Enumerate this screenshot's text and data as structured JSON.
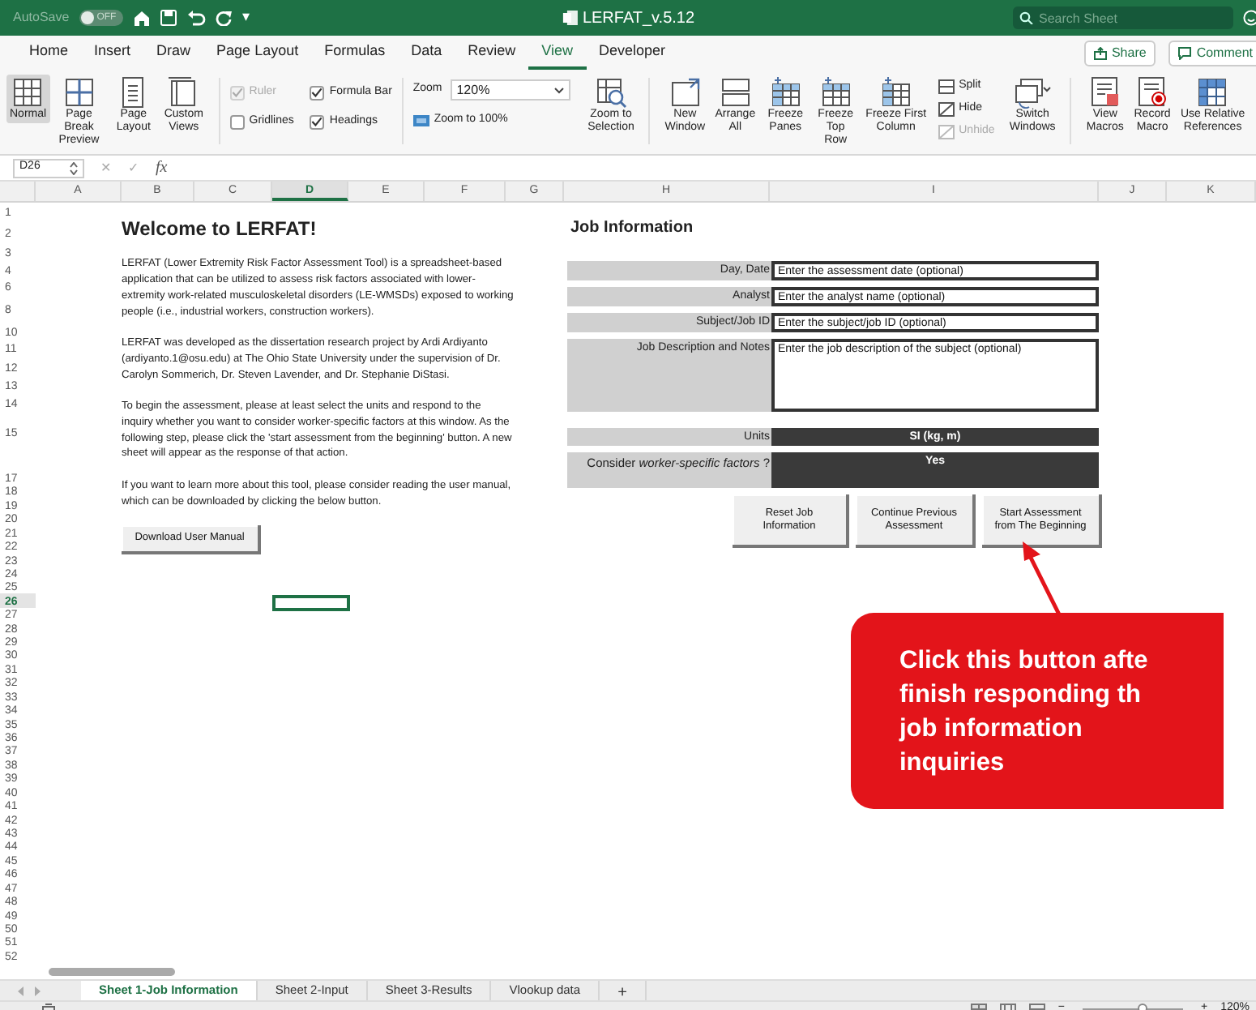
{
  "title_bar": {
    "autosave": "AutoSave",
    "autosave_state": "OFF",
    "autosave_on": false,
    "customize": "▾",
    "title": "LERFAT_v.5.12",
    "search": {
      "placeholder": "Search Sheet"
    }
  },
  "menu_tabs": [
    {
      "label": "Home",
      "selected": false
    },
    {
      "label": "Insert",
      "selected": false
    },
    {
      "label": "Draw",
      "selected": false
    },
    {
      "label": "Page Layout",
      "selected": false
    },
    {
      "label": "Formulas",
      "selected": false
    },
    {
      "label": "Data",
      "selected": false
    },
    {
      "label": "Review",
      "selected": false
    },
    {
      "label": "View",
      "selected": true
    },
    {
      "label": "Developer",
      "selected": false
    }
  ],
  "share": "Share",
  "comment": "Comment",
  "ribbon": {
    "views": [
      {
        "label": "Normal",
        "selected": true
      },
      {
        "label": "Page Break Preview",
        "selected": false
      },
      {
        "label": "Page Layout",
        "selected": false
      },
      {
        "label": "Custom Views",
        "selected": false
      }
    ],
    "show": [
      {
        "label": "Ruler",
        "checked": true,
        "disabled": true
      },
      {
        "label": "Formula Bar",
        "checked": true,
        "disabled": false
      },
      {
        "label": "Gridlines",
        "checked": false,
        "disabled": false
      },
      {
        "label": "Headings",
        "checked": true,
        "disabled": false
      }
    ],
    "zoom": {
      "label": "Zoom",
      "value": "120%",
      "reset": "Zoom to 100%",
      "selection": "Zoom to Selection"
    },
    "window": [
      {
        "label": "New Window"
      },
      {
        "label": "Arrange All"
      },
      {
        "label": "Freeze Panes"
      },
      {
        "label": "Freeze Top Row"
      },
      {
        "label": "Freeze First Column"
      }
    ],
    "split": [
      {
        "label": "Split",
        "disabled": false
      },
      {
        "label": "Hide",
        "disabled": false
      },
      {
        "label": "Unhide",
        "disabled": true
      }
    ],
    "switch": "Switch Windows",
    "macros": [
      {
        "label": "View Macros"
      },
      {
        "label": "Record Macro"
      },
      {
        "label": "Use Relative References"
      }
    ]
  },
  "formula_bar": {
    "cell": "D26",
    "cancel": "✕",
    "enter": "✓",
    "fx": "fx"
  },
  "columns": [
    {
      "label": "A",
      "selected": false
    },
    {
      "label": "B",
      "selected": false
    },
    {
      "label": "C",
      "selected": false
    },
    {
      "label": "D",
      "selected": true
    },
    {
      "label": "E",
      "selected": false
    },
    {
      "label": "F",
      "selected": false
    },
    {
      "label": "G",
      "selected": false
    },
    {
      "label": "H",
      "selected": false
    },
    {
      "label": "I",
      "selected": false
    },
    {
      "label": "J",
      "selected": false
    },
    {
      "label": "K",
      "selected": false
    }
  ],
  "rows": [
    {
      "label": "1",
      "selected": false
    },
    {
      "label": "2",
      "selected": false
    },
    {
      "label": "3",
      "selected": false
    },
    {
      "label": "4",
      "selected": false
    },
    {
      "label": "6",
      "selected": false
    },
    {
      "label": "8",
      "selected": false
    },
    {
      "label": "10",
      "selected": false
    },
    {
      "label": "11",
      "selected": false
    },
    {
      "label": "12",
      "selected": false
    },
    {
      "label": "13",
      "selected": false
    },
    {
      "label": "14",
      "selected": false
    },
    {
      "label": "15",
      "selected": false
    },
    {
      "label": "17",
      "selected": false
    },
    {
      "label": "18",
      "selected": false
    },
    {
      "label": "19",
      "selected": false
    },
    {
      "label": "20",
      "selected": false
    },
    {
      "label": "21",
      "selected": false
    },
    {
      "label": "22",
      "selected": false
    },
    {
      "label": "23",
      "selected": false
    },
    {
      "label": "24",
      "selected": false
    },
    {
      "label": "25",
      "selected": false
    },
    {
      "label": "26",
      "selected": true
    },
    {
      "label": "27",
      "selected": false
    },
    {
      "label": "28",
      "selected": false
    },
    {
      "label": "29",
      "selected": false
    },
    {
      "label": "30",
      "selected": false
    },
    {
      "label": "31",
      "selected": false
    },
    {
      "label": "32",
      "selected": false
    },
    {
      "label": "33",
      "selected": false
    },
    {
      "label": "34",
      "selected": false
    },
    {
      "label": "35",
      "selected": false
    },
    {
      "label": "36",
      "selected": false
    },
    {
      "label": "37",
      "selected": false
    },
    {
      "label": "38",
      "selected": false
    },
    {
      "label": "39",
      "selected": false
    },
    {
      "label": "40",
      "selected": false
    },
    {
      "label": "41",
      "selected": false
    },
    {
      "label": "42",
      "selected": false
    },
    {
      "label": "43",
      "selected": false
    },
    {
      "label": "44",
      "selected": false
    },
    {
      "label": "45",
      "selected": false
    },
    {
      "label": "46",
      "selected": false
    },
    {
      "label": "47",
      "selected": false
    },
    {
      "label": "48",
      "selected": false
    },
    {
      "label": "49",
      "selected": false
    },
    {
      "label": "50",
      "selected": false
    },
    {
      "label": "51",
      "selected": false
    },
    {
      "label": "52",
      "selected": false
    }
  ],
  "welcome": {
    "title": "Welcome to LERFAT!",
    "paragraphs": [
      "LERFAT (Lower Extremity Risk Factor Assessment Tool) is a spreadsheet-based application that can be utilized to assess risk factors associated with lower-extremity work-related musculoskeletal disorders (LE-WMSDs) exposed to working people (i.e., industrial workers, construction workers).",
      "LERFAT was developed as the dissertation research project by Ardi Ardiyanto (ardiyanto.1@osu.edu) at The Ohio State University under the supervision of Dr. Carolyn Sommerich, Dr. Steven Lavender, and Dr. Stephanie DiStasi.",
      "To begin the assessment, please at least select the units and respond to the inquiry whether you want to consider worker-specific factors at this window. As the following step, please click the 'start assessment from the beginning' button. A new sheet will appear as the response of that action.",
      "If you want to learn more about this tool, please consider reading the user manual, which can be downloaded by clicking the below button."
    ],
    "button": "Download User Manual"
  },
  "job_info": {
    "title": "Job Information",
    "fields": [
      {
        "label": "Day, Date",
        "placeholder": "Enter the assessment date (optional)",
        "kind": "line"
      },
      {
        "label": "Analyst",
        "placeholder": "Enter the analyst name (optional)",
        "kind": "line"
      },
      {
        "label": "Subject/Job ID",
        "placeholder": "Enter the subject/job ID (optional)",
        "kind": "line"
      },
      {
        "label": "Job Description and Notes",
        "placeholder": "Enter the job description of the subject (optional)",
        "kind": "area"
      }
    ],
    "choices": [
      {
        "label": "Units",
        "value": "SI (kg, m)"
      },
      {
        "label": "Consider *worker-specific factors* ?",
        "value": "Yes"
      }
    ],
    "buttons": [
      "Reset Job Information",
      "Continue Previous Assessment",
      "Start Assessment from The Beginning"
    ]
  },
  "callout": {
    "lines": [
      "Click this button afte",
      "finish responding th",
      "job information",
      "inquiries"
    ]
  },
  "sheet_tabs": [
    {
      "label": "Sheet 1-Job Information",
      "selected": true
    },
    {
      "label": "Sheet 2-Input",
      "selected": false
    },
    {
      "label": "Sheet 3-Results",
      "selected": false
    },
    {
      "label": "Vlookup data",
      "selected": false
    }
  ],
  "add_sheet": "+",
  "status_bar": {
    "zoom_out": "−",
    "zoom_slider": {
      "level": 0.6
    },
    "zoom_in": "+",
    "zoom": "120%"
  }
}
